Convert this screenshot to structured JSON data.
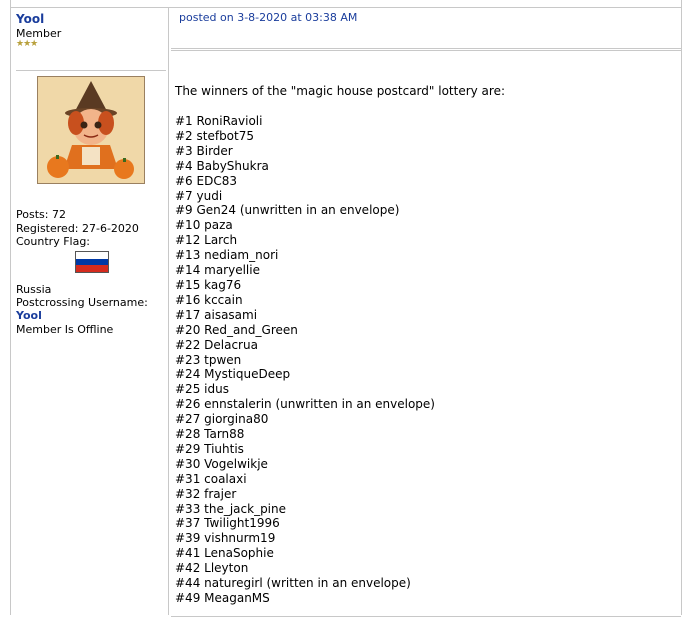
{
  "profile": {
    "username": "Yool",
    "rank": "Member",
    "stars": "★★★",
    "posts": "Posts: 72",
    "registered": "Registered: 27-6-2020",
    "country_flag_label": "Country Flag:",
    "country": "Russia",
    "pc_username_label": "Postcrossing Username:",
    "pc_username": "Yool",
    "status": "Member Is Offline",
    "flag_colors": [
      "#ffffff",
      "#0039a6",
      "#d52b1e"
    ]
  },
  "post": {
    "posted": "posted on 3-8-2020 at 03:38 AM",
    "intro": "The winners of the \"magic house postcard\" lottery are:",
    "winners": [
      "#1 RoniRavioli",
      "#2 stefbot75",
      "#3 Birder",
      "#4 BabyShukra",
      "#6 EDC83",
      "#7 yudi",
      "#9 Gen24 (unwritten in an envelope)",
      "#10 paza",
      "#12 Larch",
      "#13 nediam_nori",
      "#14 maryellie",
      "#15 kag76",
      "#16 kccain",
      "#17 aisasami",
      "#20 Red_and_Green",
      "#22 Delacrua",
      "#23 tpwen",
      "#24 MystiqueDeep",
      "#25 idus",
      "#26 ennstalerin (unwritten in an envelope)",
      "#27 giorgina80",
      "#28 Tarn88",
      "#29 Tiuhtis",
      "#30 Vogelwikje",
      "#31 coalaxi",
      "#32 frajer",
      "#33 the_jack_pine",
      "#37 Twilight1996",
      "#39 vishnurm19",
      "#41 LenaSophie",
      "#42 Lleyton",
      "#44 naturegirl (written in an envelope)",
      "#49 MeaganMS"
    ]
  }
}
